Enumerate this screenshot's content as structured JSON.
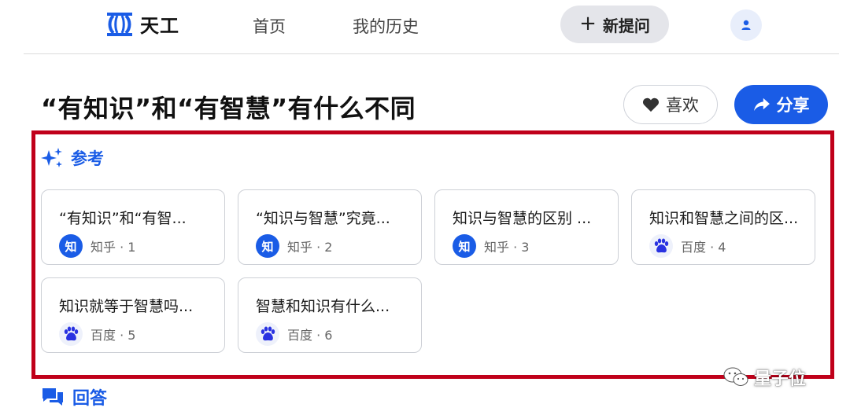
{
  "nav": {
    "brand": "天工",
    "home": "首页",
    "history": "我的历史",
    "new_question": "新提问",
    "brand_color": "#1a5ce6"
  },
  "page": {
    "title": "“有知识”和“有智慧”有什么不同",
    "like_label": "喜欢",
    "share_label": "分享"
  },
  "references": {
    "header": "参考",
    "highlight_color": "#c0001a",
    "cards": [
      {
        "title": "“有知识”和“有智...",
        "source": "知乎 · 1",
        "icon": "zhihu-icon"
      },
      {
        "title": "“知识与智慧”究竟...",
        "source": "知乎 · 2",
        "icon": "zhihu-icon"
      },
      {
        "title": "知识与智慧的区别 ...",
        "source": "知乎 · 3",
        "icon": "zhihu-icon"
      },
      {
        "title": "知识和智慧之间的区...",
        "source": "百度 · 4",
        "icon": "baidu-icon"
      },
      {
        "title": "知识就等于智慧吗...",
        "source": "百度 · 5",
        "icon": "baidu-icon"
      },
      {
        "title": "智慧和知识有什么...",
        "source": "百度 · 6",
        "icon": "baidu-icon"
      }
    ],
    "zhihu_glyph": "知"
  },
  "answer": {
    "header": "回答"
  },
  "watermark": {
    "text": "量子位"
  }
}
